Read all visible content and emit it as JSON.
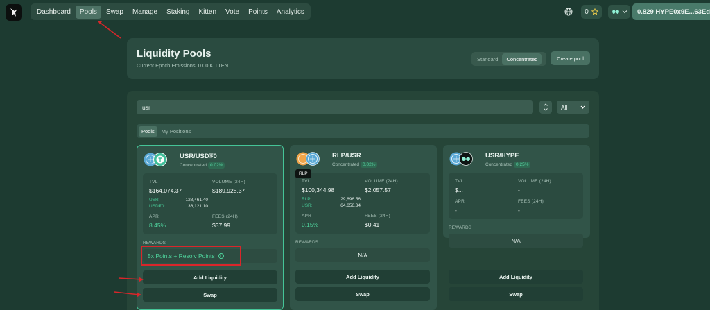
{
  "nav": {
    "items": [
      "Dashboard",
      "Pools",
      "Swap",
      "Manage",
      "Staking",
      "Kitten",
      "Vote",
      "Points",
      "Analytics"
    ],
    "active": "Pools"
  },
  "topbar": {
    "points_count": "0",
    "wallet_balance": "0.829 HYPE",
    "wallet_address": "0x9E...63Ed"
  },
  "header": {
    "title": "Liquidity Pools",
    "subtitle": "Current Epoch Emissions: 0.00 KITTEN",
    "mode_standard": "Standard",
    "mode_concentrated": "Concentrated",
    "create_pool": "Create pool"
  },
  "filters": {
    "search_value": "usr",
    "select_value": "All"
  },
  "tabs": {
    "pools": "Pools",
    "positions": "My Positions"
  },
  "labels": {
    "tvl": "TVL",
    "volume": "VOLUME (24H)",
    "apr": "APR",
    "fees": "FEES (24H)",
    "rewards": "REWARDS",
    "add_liquidity": "Add Liquidity",
    "swap": "Swap"
  },
  "pools": [
    {
      "name": "USR/USD₮0",
      "type": "Concentrated",
      "fee": "0.02%",
      "tvl": "$164,074.37",
      "volume": "$189,928.37",
      "tokenA": "USR:",
      "amountA": "128,461.40",
      "tokenB": "USD₮0:",
      "amountB": "36,121.10",
      "apr": "8.45%",
      "fees": "$37.99",
      "rewards": "5x Points + Resolv Points"
    },
    {
      "name": "RLP/USR",
      "type": "Concentrated",
      "fee": "0.02%",
      "tvl": "$100,344.98",
      "volume": "$2,057.57",
      "tokenA": "RLP:",
      "amountA": "29,696.56",
      "tokenB": "USR:",
      "amountB": "64,656.34",
      "apr": "0.15%",
      "fees": "$0.41",
      "rewards": "N/A",
      "tooltip": "RLP"
    },
    {
      "name": "USR/HYPE",
      "type": "Concentrated",
      "fee": "0.25%",
      "tvl": "$...",
      "volume": "-",
      "apr": "-",
      "fees": "-",
      "rewards": "N/A"
    }
  ],
  "colors": {
    "background": "#1d3b31",
    "card": "#264538",
    "accent_green": "#4fd49d",
    "annotation_red": "#d9262a"
  }
}
